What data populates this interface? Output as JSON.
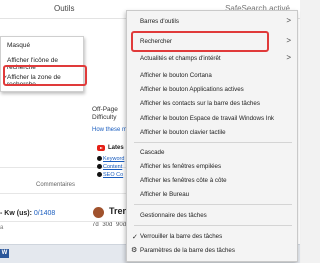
{
  "topbar": {
    "tools": "Outils",
    "safesearch": "SafeSearch activé"
  },
  "background": {
    "keyword_label": "- Kw",
    "keyword_unit": "(us):",
    "keyword_num": "0/1408",
    "cut_text": "a",
    "comments": "Commentaires",
    "offpage_title": "Off-Page",
    "difficulty": "Difficulty",
    "how_measure": "How these m",
    "latest": "Lates",
    "links": [
      "Keyword",
      "Content",
      "SEO Co"
    ],
    "trend_title": "Tren",
    "periods": "7d   30d   90d",
    "word_icon": "W"
  },
  "submenu": {
    "items": [
      {
        "label": "Masqué"
      },
      {
        "label": "Afficher l'icône de recherche"
      },
      {
        "label": "Afficher la zone de recherche",
        "checked": true
      }
    ]
  },
  "context_menu": {
    "items": [
      {
        "label": "Barres d'outils",
        "arrow": ">"
      },
      {
        "label": "Rechercher",
        "arrow": ">",
        "highlighted": true
      },
      {
        "label": "Actualités et champs d'intérêt",
        "arrow": ">"
      },
      {
        "label": "Afficher le bouton Cortana"
      },
      {
        "label": "Afficher le bouton Applications actives"
      },
      {
        "label": "Afficher les contacts sur la barre des tâches"
      },
      {
        "label": "Afficher le bouton Espace de travail Windows Ink"
      },
      {
        "label": "Afficher le bouton clavier tactile"
      },
      {
        "label": "Cascade"
      },
      {
        "label": "Afficher les fenêtres empilées"
      },
      {
        "label": "Afficher les fenêtres côte à côte"
      },
      {
        "label": "Afficher le Bureau"
      },
      {
        "label": "Gestionnaire des tâches"
      },
      {
        "label": "Verrouiller la barre des tâches",
        "checked": true
      },
      {
        "label": "Paramètres de la barre des tâches",
        "icon": "gear-icon"
      }
    ]
  },
  "colors": {
    "highlight_border": "#e03a3a",
    "link": "#1a5dbf",
    "youtube": "#e62117"
  }
}
